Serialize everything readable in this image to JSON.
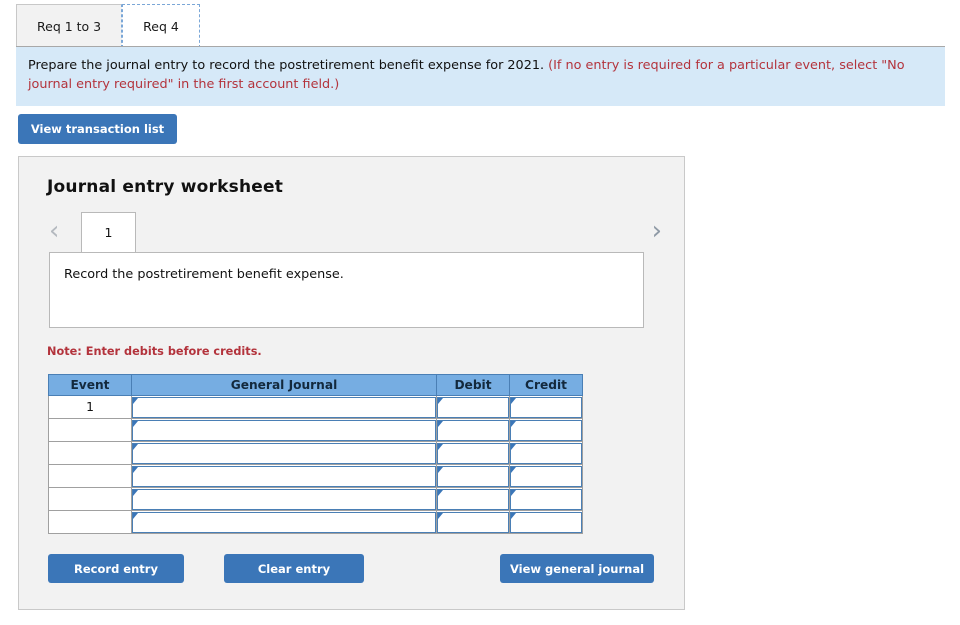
{
  "req_tabs": [
    {
      "label": "Req 1 to 3",
      "active": true
    },
    {
      "label": "Req 4",
      "active": false
    }
  ],
  "instruction": {
    "main": "Prepare the journal entry to record the postretirement benefit expense for 2021.",
    "hint": "(If no entry is required for a particular event, select \"No journal entry required\" in the first account field.)",
    "hint_color": "#b3333c",
    "background_color": "#d6e9f8"
  },
  "toolbar": {
    "view_transaction_list_label": "View transaction list"
  },
  "worksheet": {
    "title": "Journal entry worksheet",
    "pager": {
      "prev_icon": "chevron-left-icon",
      "next_icon": "chevron-right-icon",
      "current_page": "1"
    },
    "description": "Record the postretirement benefit expense.",
    "note": "Note: Enter debits before credits.",
    "note_color": "#b3333c",
    "table": {
      "header_color": "#76ade2",
      "columns": [
        "Event",
        "General Journal",
        "Debit",
        "Credit"
      ],
      "rows": [
        {
          "event": "1",
          "general_journal": "",
          "debit": "",
          "credit": ""
        },
        {
          "event": "",
          "general_journal": "",
          "debit": "",
          "credit": ""
        },
        {
          "event": "",
          "general_journal": "",
          "debit": "",
          "credit": ""
        },
        {
          "event": "",
          "general_journal": "",
          "debit": "",
          "credit": ""
        },
        {
          "event": "",
          "general_journal": "",
          "debit": "",
          "credit": ""
        },
        {
          "event": "",
          "general_journal": "",
          "debit": "",
          "credit": ""
        }
      ]
    },
    "buttons": {
      "record_entry_label": "Record entry",
      "clear_entry_label": "Clear entry",
      "view_general_journal_label": "View general journal",
      "button_color": "#3b76b8"
    }
  }
}
